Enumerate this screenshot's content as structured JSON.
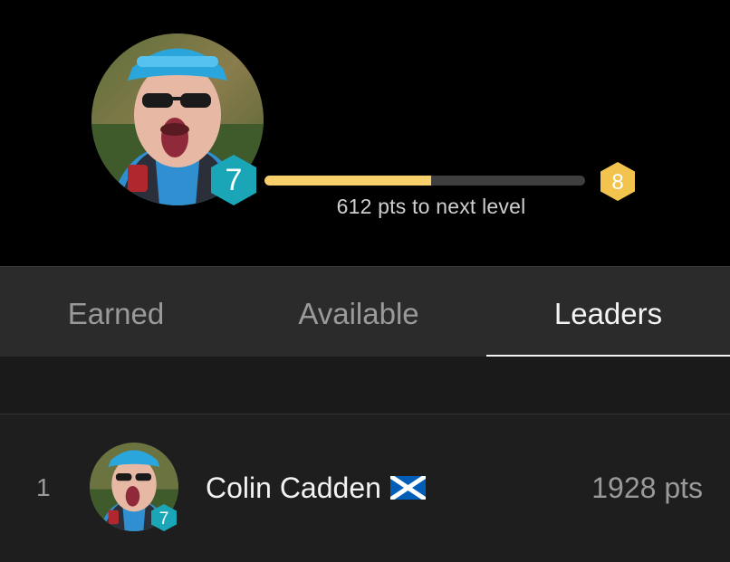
{
  "header": {
    "current_level": "7",
    "next_level": "8",
    "progress_fraction": 0.52,
    "progress_text": "612 pts to next level"
  },
  "tabs": [
    {
      "label": "Earned"
    },
    {
      "label": "Available"
    },
    {
      "label": "Leaders"
    }
  ],
  "active_tab": "Leaders",
  "leaderboard": [
    {
      "rank": "1",
      "name": "Colin Cadden",
      "level": "7",
      "points": "1928 pts"
    }
  ],
  "colors": {
    "header_bg": "#000000",
    "progress_fill": "#f7d06b",
    "progress_track": "#3f3f3f",
    "level_badge": "#1ba6b8",
    "next_level_badge": "#f2c44d",
    "scotland_flag_blue": "#005eb8"
  },
  "icons": [
    "avatar",
    "level-badge-hexagon",
    "next-level-hexagon",
    "scotland-flag"
  ]
}
